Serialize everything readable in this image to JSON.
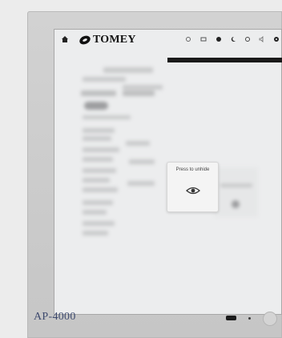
{
  "device": {
    "model": "AP-4000",
    "brand": "TOMEY"
  },
  "topbar": {
    "icons": [
      "home-icon",
      "brightness-icon",
      "display-icon",
      "help-icon",
      "night-mode-icon",
      "settings-icon",
      "volume-icon",
      "gear-icon"
    ]
  },
  "privacy_overlay": {
    "prompt": "Press to unhide",
    "icon": "eye-icon"
  },
  "colors": {
    "screen_background": "#ecedee",
    "bezel": "#c9c9c9",
    "model_text": "#3e4a6e"
  }
}
